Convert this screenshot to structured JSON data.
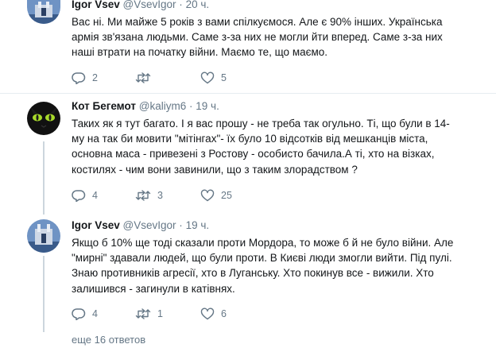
{
  "tweets": [
    {
      "name": "",
      "handle": "",
      "time": "",
      "lines": [
        "Вас ні. Ми майже 5 років з вами спілкуємося. Але є 90% інших. Українська",
        "армія зв'язана людьми. Саме з-за них не могли йти вперед. Саме з-за них",
        "наші втрати на початку війни. Маємо те, що маємо."
      ],
      "reply_count": "2",
      "retweet_count": "",
      "like_count": "5"
    },
    {
      "name": "Кот Бегемот",
      "handle": "@kaliym6",
      "time": "19 ч.",
      "lines": [
        "Таких як я тут багато. І я вас прошу - не треба так огульно. Ті, що були в 14-",
        "му на так би мовити \"мітінгах\"- їх було 10 відсотків від мешканців міста,",
        "основна маса - привезені з Ростову - особисто бачила.А ті, хто на візках,",
        "костилях - чим вони завинили, що з таким злорадством ?"
      ],
      "reply_count": "4",
      "retweet_count": "3",
      "like_count": "25"
    },
    {
      "name": "Igor Vsev",
      "handle": "@VsevIgor",
      "time": "19 ч.",
      "lines": [
        "Якщо б 10% ще тоді сказали проти Мордора, то може б й не було війни. Але",
        "\"мирні\" здавали людей, що були проти. В Києві люди змогли вийти. Під пулі.",
        "Знаю противників агресії, хто в Луганську. Хто покинув все - вижили. Хто",
        "залишився - загинули в катівнях."
      ],
      "reply_count": "4",
      "retweet_count": "1",
      "like_count": "6"
    }
  ],
  "top_header": {
    "name": "Igor Vsev",
    "handle": "@VsevIgor",
    "time": "20 ч."
  },
  "dot": "·",
  "more_replies": "еще 16 ответов",
  "colors": {
    "text": "#14171a",
    "muted": "#657786",
    "line": "#ccd6dd",
    "separator": "#e6ecf0"
  },
  "icons": [
    "reply-icon",
    "retweet-icon",
    "like-icon"
  ]
}
